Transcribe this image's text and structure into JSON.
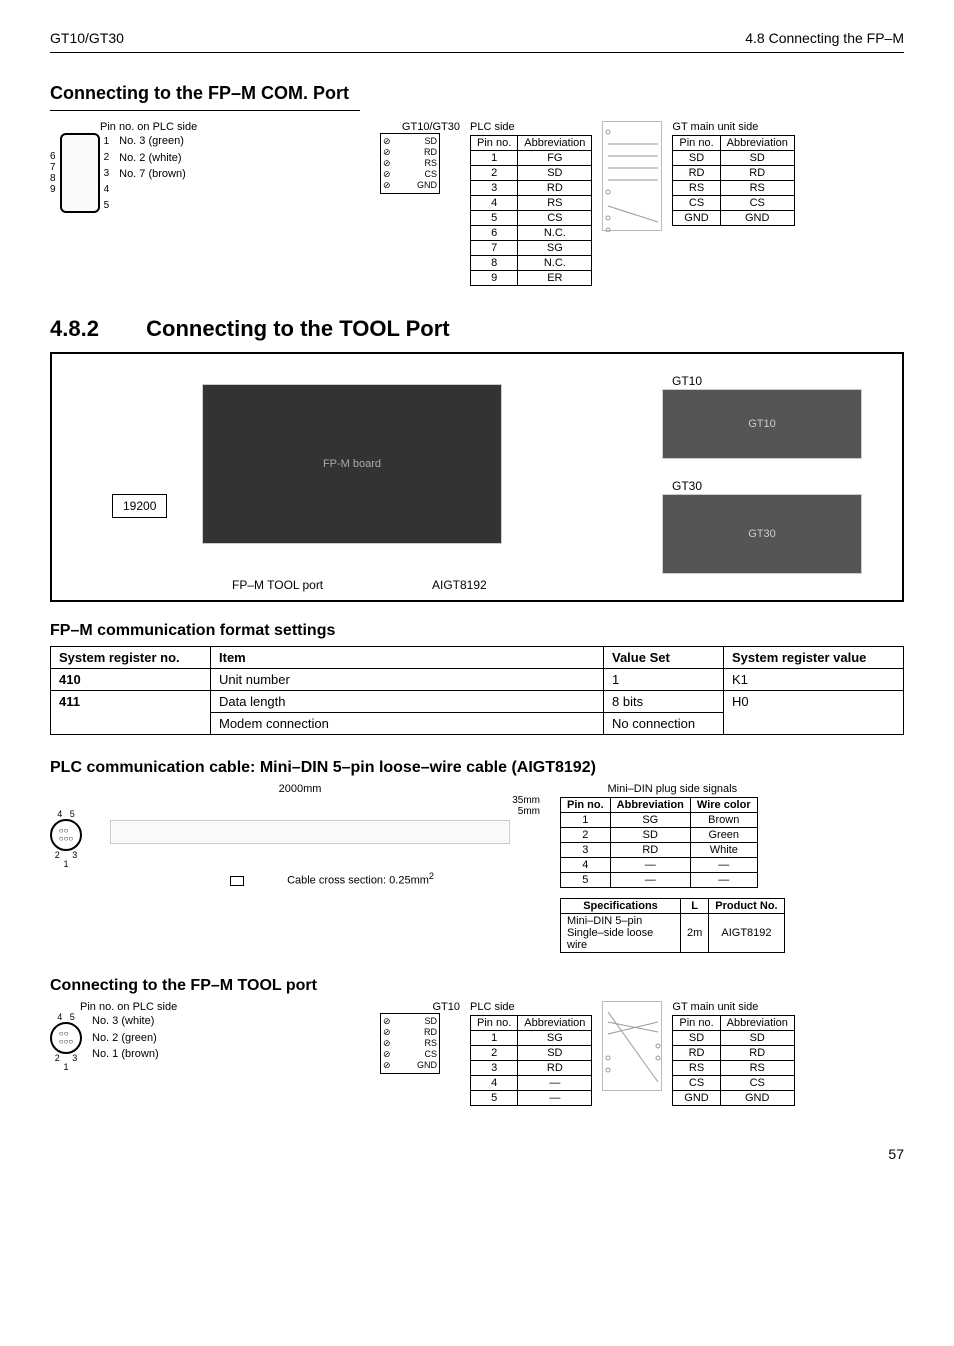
{
  "header": {
    "left": "GT10/GT30",
    "right": "4.8   Connecting the FP–M"
  },
  "s1": {
    "title": "Connecting to the FP–M COM. Port",
    "plc_legend_title": "Pin no. on PLC side",
    "gt_label": "GT10/GT30",
    "conn_pins_left": [
      "6",
      "7",
      "8",
      "9"
    ],
    "conn_pins_right": [
      "1",
      "2",
      "3",
      "4",
      "5"
    ],
    "wires": [
      "No. 3 (green)",
      "No. 2 (white)",
      "No. 7 (brown)"
    ],
    "term_labels": [
      "SD",
      "RD",
      "RS",
      "CS",
      "GND"
    ],
    "plc_side_title": "PLC side",
    "plc_headers": [
      "Pin no.",
      "Abbreviation"
    ],
    "plc_rows": [
      [
        "1",
        "FG"
      ],
      [
        "2",
        "SD"
      ],
      [
        "3",
        "RD"
      ],
      [
        "4",
        "RS"
      ],
      [
        "5",
        "CS"
      ],
      [
        "6",
        "N.C."
      ],
      [
        "7",
        "SG"
      ],
      [
        "8",
        "N.C."
      ],
      [
        "9",
        "ER"
      ]
    ],
    "gt_side_title": "GT main unit side",
    "gt_headers": [
      "Pin no.",
      "Abbreviation"
    ],
    "gt_rows": [
      [
        "SD",
        "SD"
      ],
      [
        "RD",
        "RD"
      ],
      [
        "RS",
        "RS"
      ],
      [
        "CS",
        "CS"
      ],
      [
        "GND",
        "GND"
      ]
    ]
  },
  "s2": {
    "secnum": "4.8.2",
    "title": "Connecting to the TOOL Port",
    "gt10_label": "GT10",
    "gt30_label": "GT30",
    "baud": "19200",
    "fpm_port": "FP–M TOOL port",
    "cable_part": "AIGT8192"
  },
  "s3": {
    "title": "FP–M communication format settings",
    "headers": [
      "System register no.",
      "Item",
      "Value Set",
      "System register value"
    ],
    "rows": [
      [
        "410",
        "Unit number",
        "1",
        "K1"
      ],
      [
        "411",
        "Data length",
        "8 bits",
        "H0"
      ],
      [
        "",
        "Modem connection",
        "No connection",
        ""
      ]
    ]
  },
  "s4": {
    "title": "PLC communication cable: Mini–DIN 5–pin loose–wire cable (AIGT8192)",
    "len_label": "2000mm",
    "len35": "35mm",
    "len5": "5mm",
    "cross": "Cable cross section: 0.25mm",
    "cross_sup": "2",
    "din_pins": [
      "4",
      "5",
      "2",
      "3",
      "1"
    ],
    "signals_title": "Mini–DIN plug side signals",
    "signals_headers": [
      "Pin no.",
      "Abbreviation",
      "Wire color"
    ],
    "signals_rows": [
      [
        "1",
        "SG",
        "Brown"
      ],
      [
        "2",
        "SD",
        "Green"
      ],
      [
        "3",
        "RD",
        "White"
      ],
      [
        "4",
        "—",
        "—"
      ],
      [
        "5",
        "—",
        "—"
      ]
    ],
    "spec_headers": [
      "Specifications",
      "L",
      "Product No."
    ],
    "spec_row": [
      "Mini–DIN 5–pin Single–side loose wire",
      "2m",
      "AIGT8192"
    ]
  },
  "s5": {
    "title": "Connecting to the FP–M TOOL port",
    "plc_legend_title": "Pin no. on PLC side",
    "gt_label": "GT10",
    "din_pins": [
      "4",
      "5",
      "2",
      "3",
      "1"
    ],
    "wires": [
      "No. 3 (white)",
      "No. 2 (green)",
      "No. 1 (brown)"
    ],
    "term_labels": [
      "SD",
      "RD",
      "RS",
      "CS",
      "GND"
    ],
    "plc_side_title": "PLC side",
    "plc_headers": [
      "Pin no.",
      "Abbreviation"
    ],
    "plc_rows": [
      [
        "1",
        "SG"
      ],
      [
        "2",
        "SD"
      ],
      [
        "3",
        "RD"
      ],
      [
        "4",
        "—"
      ],
      [
        "5",
        "—"
      ]
    ],
    "gt_side_title": "GT main unit side",
    "gt_headers": [
      "Pin no.",
      "Abbreviation"
    ],
    "gt_rows": [
      [
        "SD",
        "SD"
      ],
      [
        "RD",
        "RD"
      ],
      [
        "RS",
        "RS"
      ],
      [
        "CS",
        "CS"
      ],
      [
        "GND",
        "GND"
      ]
    ]
  },
  "page_number": "57"
}
